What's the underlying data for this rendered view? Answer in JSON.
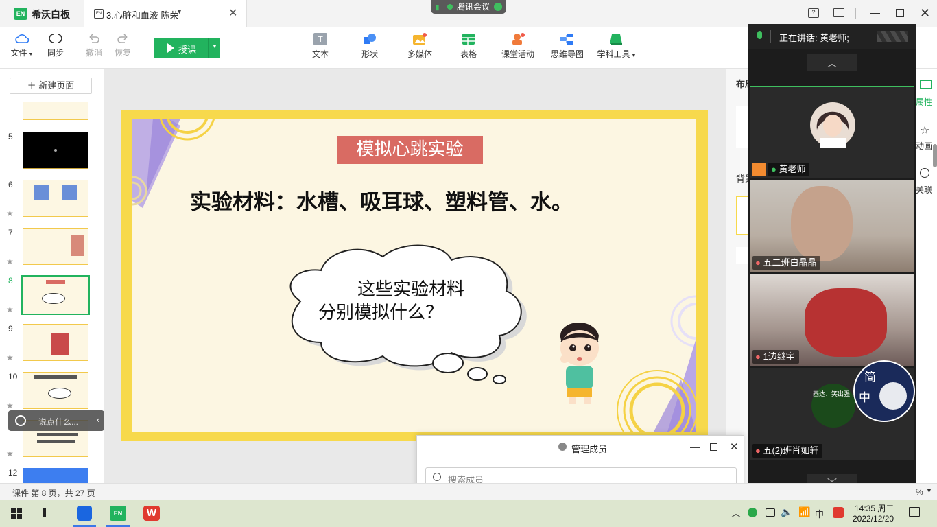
{
  "titlebar": {
    "app_name": "希沃白板",
    "logo_text": "EN",
    "tab_title": "3.心脏和血液 陈荣",
    "tab_doc_icon_text": "EN",
    "meeting_label": "腾讯会议"
  },
  "toolbar": {
    "file": "文件",
    "sync": "同步",
    "undo": "撤消",
    "redo": "恢复",
    "teach": "授课",
    "tools": [
      "文本",
      "形状",
      "多媒体",
      "表格",
      "课堂活动",
      "思维导图",
      "学科工具"
    ]
  },
  "left_panel": {
    "new_page": "新建页面",
    "pages": [
      "5",
      "6",
      "7",
      "8",
      "9",
      "10",
      "12"
    ],
    "current_page": "8"
  },
  "slide": {
    "heading": "模拟心跳实验",
    "materials": "实验材料：水槽、吸耳球、塑料管、水。",
    "bubble_line1": "这些实验材料",
    "bubble_line2": "分别模拟什么？"
  },
  "chat_box": {
    "placeholder": "说点什么..."
  },
  "right_panel": {
    "tab_layout": "布局",
    "tab_background": "背景",
    "side_attrs": "属性",
    "side_animate": "动画",
    "side_link": "关联"
  },
  "video_panel": {
    "speaking": "正在讲话: 黄老师;",
    "participants": [
      "黄老师",
      "五二班白晶晶",
      "1边继宇",
      "五(2)班肖如轩"
    ],
    "overlay_text1": "简",
    "overlay_text2": "中",
    "small_overlay_text": "画达、笑出强"
  },
  "members_dialog": {
    "title": "管理成员",
    "search_placeholder": "搜索成员"
  },
  "status_bar": {
    "page_info": "课件 第 8 页，共 27 页",
    "zoom_fragment": "%"
  },
  "taskbar": {
    "wps_label": "W",
    "ime": "中",
    "time": "14:35 周二",
    "date": "2022/12/20"
  },
  "colors": {
    "accent_green": "#22b35e",
    "slide_border": "#f7d94c",
    "slide_bg": "#fcf6e2",
    "heading_bg": "#d96b63"
  }
}
